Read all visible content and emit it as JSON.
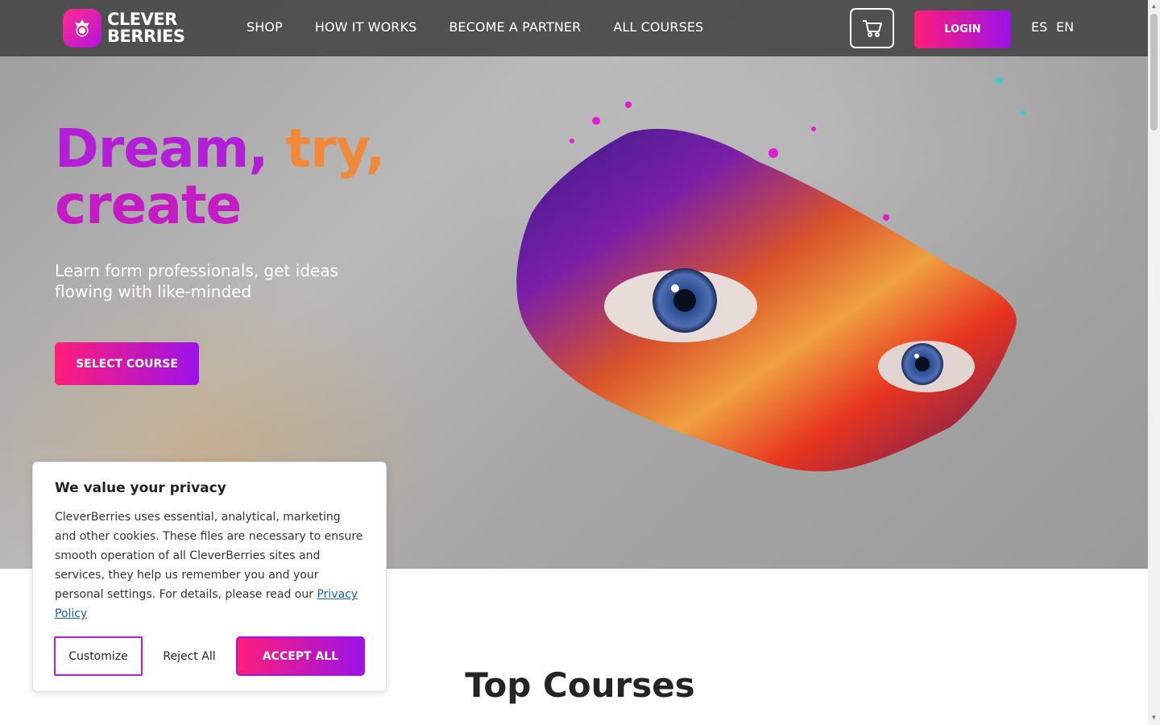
{
  "brand": {
    "line1": "CLEVER",
    "line2": "BERRIES"
  },
  "nav": [
    {
      "label": "SHOP"
    },
    {
      "label": "HOW IT WORKS"
    },
    {
      "label": "BECOME A PARTNER"
    },
    {
      "label": "ALL COURSES"
    }
  ],
  "header": {
    "login_label": "LOGIN",
    "lang_es": "ES",
    "lang_en": "EN"
  },
  "hero": {
    "headline_dream": "Dream,",
    "headline_try": "try,",
    "headline_create": "create",
    "subtitle": "Learn form professionals, get ideas flowing with like-minded",
    "cta_label": "SELECT COURSE"
  },
  "section": {
    "title": "Top Courses"
  },
  "cookie": {
    "title": "We value your privacy",
    "body": "CleverBerries uses essential, analytical, marketing and other cookies. These files are necessary to ensure smooth operation of all CleverBerries sites and services, they help us remember you and your personal settings. For details, please read our",
    "link": "Privacy Policy",
    "customize_label": "Customize",
    "reject_label": "Reject All",
    "accept_label": "ACCEPT ALL"
  },
  "colors": {
    "accent_start": "#ff1e78",
    "accent_end": "#9b12e8"
  },
  "icons": {
    "cart": "cart-icon",
    "logo": "berry-logo-icon"
  }
}
